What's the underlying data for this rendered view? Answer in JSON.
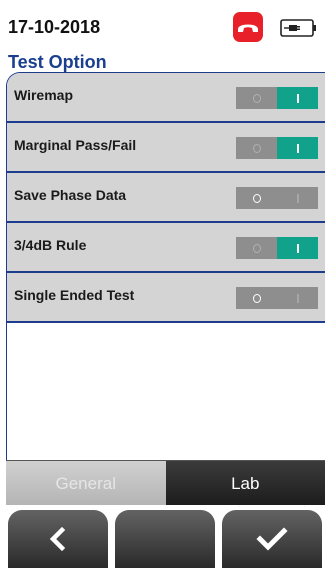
{
  "status": {
    "date": "17-10-2018",
    "phone_icon": "hangup-phone-icon",
    "battery_icon": "power-plug-battery-icon",
    "phone_color": "#e8202a"
  },
  "section": {
    "title": "Test Option"
  },
  "options": [
    {
      "label": "Wiremap",
      "enabled": true
    },
    {
      "label": "Marginal Pass/Fail",
      "enabled": true
    },
    {
      "label": "Save Phase Data",
      "enabled": false
    },
    {
      "label": "3/4dB Rule",
      "enabled": true
    },
    {
      "label": "Single Ended Test",
      "enabled": false
    }
  ],
  "tabs": [
    {
      "label": "General",
      "active": false
    },
    {
      "label": "Lab",
      "active": true
    }
  ],
  "nav": {
    "back_icon": "chevron-left-icon",
    "confirm_icon": "checkmark-icon"
  },
  "colors": {
    "accent": "#1e3c8c",
    "toggle_on": "#10a28a",
    "toggle_off": "#8e8e8e"
  }
}
